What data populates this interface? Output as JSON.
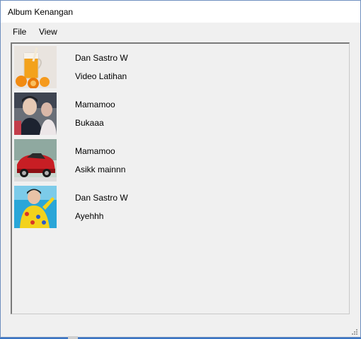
{
  "window": {
    "title": "Album Kenangan"
  },
  "menu": {
    "file": "File",
    "view": "View"
  },
  "items": [
    {
      "thumbnail": "orange-juice-image",
      "artist": "Dan Sastro W",
      "title": "Video Latihan"
    },
    {
      "thumbnail": "person-photo-image",
      "artist": "Mamamoo",
      "title": "Bukaaa"
    },
    {
      "thumbnail": "red-car-image",
      "artist": "Mamamoo",
      "title": "Asikk mainnn"
    },
    {
      "thumbnail": "yellow-outfit-person-image",
      "artist": "Dan Sastro W",
      "title": "Ayehhh"
    }
  ],
  "colors": {
    "titlebar": "#ffffff",
    "window": "#f0f0f0",
    "desktop": "#3a75c4"
  }
}
